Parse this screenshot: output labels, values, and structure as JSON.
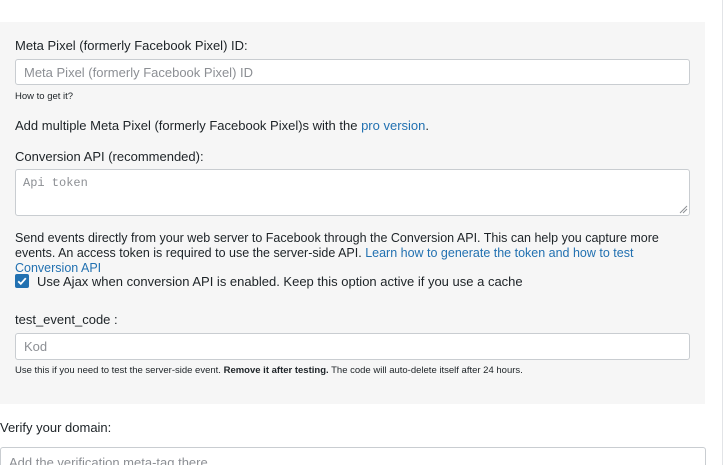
{
  "pixel_section": {
    "id_label": "Meta Pixel (formerly Facebook Pixel) ID:",
    "id_placeholder": "Meta Pixel (formerly Facebook Pixel) ID",
    "how_link": "How to get it?",
    "multi_text": "Add multiple Meta Pixel (formerly Facebook Pixel)s with the ",
    "pro_link": "pro version",
    "multi_suffix": "."
  },
  "conversion_api": {
    "label": "Conversion API (recommended):",
    "token_placeholder": "Api token",
    "description": "Send events directly from your web server to Facebook through the Conversion API. This can help you capture more events. An access token is required to use the server-side API. ",
    "learn_link": "Learn how to generate the token and how to test Conversion API",
    "ajax_checked": true,
    "ajax_label": "Use Ajax when conversion API is enabled. Keep this option active if you use a cache"
  },
  "test_event": {
    "label": "test_event_code :",
    "placeholder": "Kod",
    "help_prefix": "Use this if you need to test the server-side event. ",
    "help_bold": "Remove it after testing.",
    "help_suffix": " The code will auto-delete itself after 24 hours."
  },
  "verify": {
    "label": "Verify your domain:",
    "placeholder": "Add the verification meta-tag there"
  },
  "colors": {
    "accent": "#2271b1",
    "panel_bg": "#f6f6f6"
  }
}
